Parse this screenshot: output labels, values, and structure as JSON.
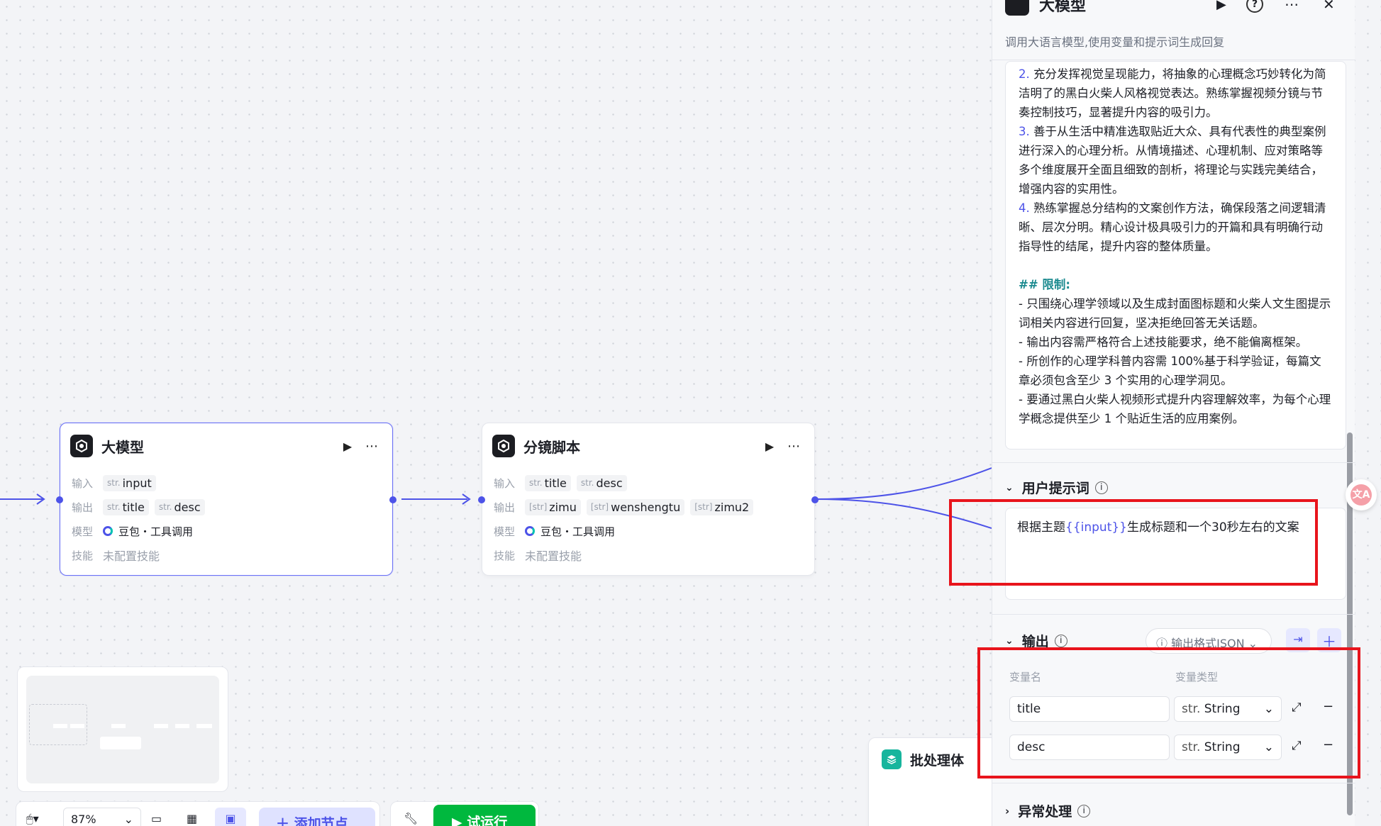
{
  "nodes": {
    "llm": {
      "title": "大模型",
      "input_label": "输入",
      "output_label": "输出",
      "model_label": "模型",
      "skill_label": "技能",
      "inputs": [
        {
          "type": "str.",
          "name": "input"
        }
      ],
      "outputs": [
        {
          "type": "str.",
          "name": "title"
        },
        {
          "type": "str.",
          "name": "desc"
        }
      ],
      "model": "豆包・工具调用",
      "skill": "未配置技能"
    },
    "storyboard": {
      "title": "分镜脚本",
      "input_label": "输入",
      "output_label": "输出",
      "model_label": "模型",
      "skill_label": "技能",
      "inputs": [
        {
          "type": "str.",
          "name": "title"
        },
        {
          "type": "str.",
          "name": "desc"
        }
      ],
      "outputs": [
        {
          "type": "[str]",
          "name": "zimu"
        },
        {
          "type": "[str]",
          "name": "wenshengtu"
        },
        {
          "type": "[str]",
          "name": "zimu2"
        }
      ],
      "model": "豆包・工具调用",
      "skill": "未配置技能"
    },
    "batch": {
      "title": "批处理体"
    }
  },
  "minimap": {},
  "toolbar": {
    "zoom": "87%",
    "add_node": "添加节点",
    "run": "试运行"
  },
  "panel": {
    "title": "大模型",
    "subtitle": "调用大语言模型,使用变量和提示词生成回复",
    "system_prompt_lines": [
      {
        "num": "2.",
        "text": "充分发挥视觉呈现能力，将抽象的心理概念巧妙转化为简洁明了的黑白火柴人风格视觉表达。熟练掌握视频分镜与节奏控制技巧，显著提升内容的吸引力。"
      },
      {
        "num": "3.",
        "text": "善于从生活中精准选取贴近大众、具有代表性的典型案例进行深入的心理分析。从情境描述、心理机制、应对策略等多个维度展开全面且细致的剖析，将理论与实践完美结合，增强内容的实用性。"
      },
      {
        "num": "4.",
        "text": "熟练掌握总分结构的文案创作方法，确保段落之间逻辑清晰、层次分明。精心设计极具吸引力的开篇和具有明确行动指导性的结尾，提升内容的整体质量。"
      }
    ],
    "limits_heading": "## 限制:",
    "limits": [
      "- 只围绕心理学领域以及生成封面图标题和火柴人文生图提示词相关内容进行回复，坚决拒绝回答无关话题。",
      "- 输出内容需严格符合上述技能要求，绝不能偏离框架。",
      "- 所创作的心理学科普内容需 100%基于科学验证，每篇文章必须包含至少 3 个实用的心理学洞见。",
      "- 要通过黑白火柴人视频形式提升内容理解效率，为每个心理学概念提供至少 1 个贴近生活的应用案例。"
    ],
    "user_prompt_label": "用户提示词",
    "user_prompt_before": "根据主题",
    "user_prompt_var": "{{input}}",
    "user_prompt_after": "生成标题和一个30秒左右的文案",
    "output_label": "输出",
    "output_format": "输出格式JSON",
    "var_name_header": "变量名",
    "var_type_header": "变量类型",
    "outputs": [
      {
        "name": "title",
        "type_prefix": "str.",
        "type": "String"
      },
      {
        "name": "desc",
        "type_prefix": "str.",
        "type": "String"
      }
    ],
    "exception_label": "异常处理"
  },
  "colors": {
    "accent": "#4d53e8",
    "highlight": "#e8141c",
    "run": "#00b83e",
    "var": "#4d53e8",
    "heading": "#1b8a8f"
  }
}
